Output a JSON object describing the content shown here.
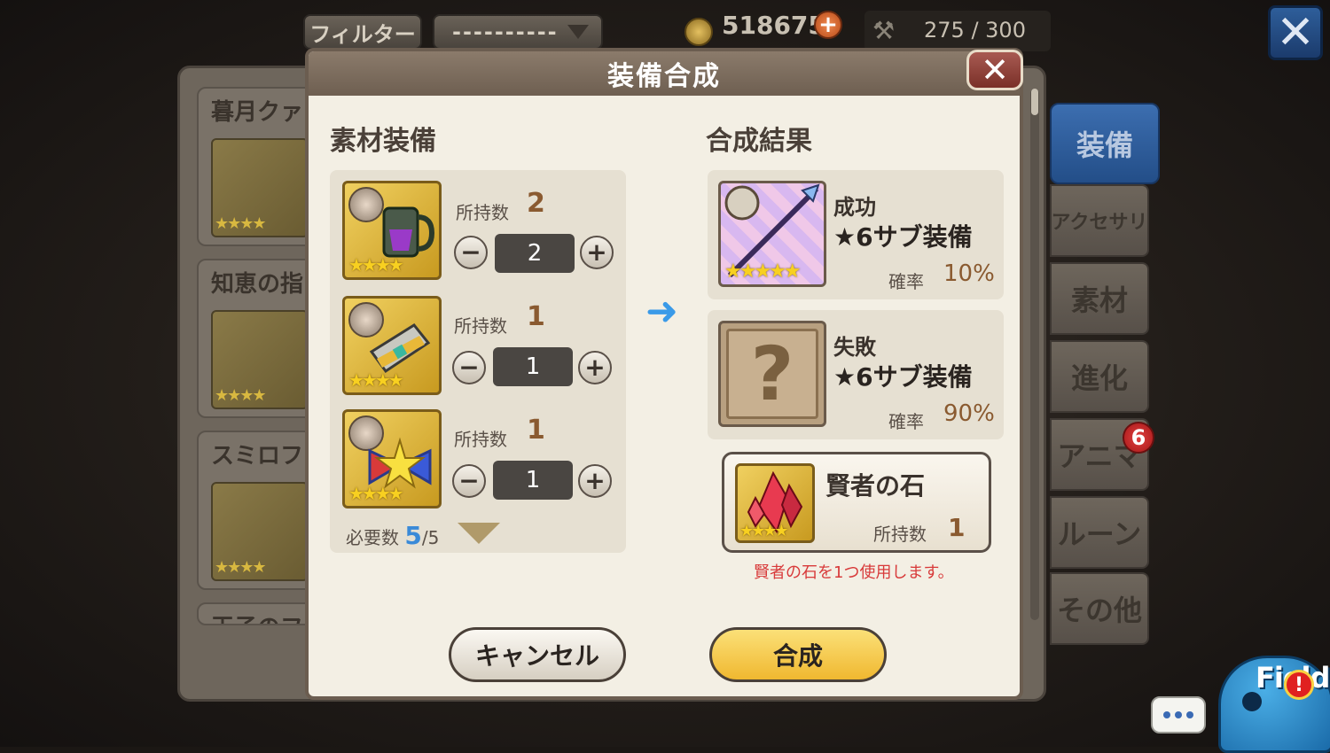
{
  "topbar": {
    "filter_label": "フィルター",
    "dropdown_value": "----------",
    "coins": "518675",
    "capacity": "275 / 300"
  },
  "list_cards": [
    {
      "title": "暮月クァ"
    },
    {
      "title": "知恵の指"
    },
    {
      "title": "スミロフ"
    },
    {
      "title": "王子のフ"
    }
  ],
  "tabs": [
    {
      "label": "装備"
    },
    {
      "label": "アクセサリ"
    },
    {
      "label": "素材"
    },
    {
      "label": "進化"
    },
    {
      "label": "アニマ"
    },
    {
      "label": "ルーン"
    },
    {
      "label": "その他"
    }
  ],
  "anima_badge": "6",
  "mascot_label": "Field",
  "dialog": {
    "title": "装備合成",
    "materials_header": "素材装備",
    "result_header": "合成結果",
    "owned_label": "所持数",
    "materials": [
      {
        "owned": "2",
        "qty": "2",
        "stars": "★★★★"
      },
      {
        "owned": "1",
        "qty": "1",
        "stars": "★★★★"
      },
      {
        "owned": "1",
        "qty": "1",
        "stars": "★★★★"
      }
    ],
    "required_label": "必要数",
    "required_count": "5",
    "required_total": "/5",
    "success": {
      "label": "成功",
      "name": "★6サブ装備",
      "prob_label": "確率",
      "prob": "10%",
      "stars": "★★★★★"
    },
    "failure": {
      "label": "失敗",
      "name": "★6サブ装備",
      "prob_label": "確率",
      "prob": "90%",
      "icon": "?"
    },
    "sage_stone": {
      "name": "賢者の石",
      "owned_label": "所持数",
      "owned": "1",
      "stars": "★★★★"
    },
    "note": "賢者の石を1つ使用します。",
    "cancel_label": "キャンセル",
    "combine_label": "合成"
  },
  "colors": {
    "accent_blue": "#3a8ad8",
    "gold_button": "#f0b830",
    "header_brown": "#7a6b5c",
    "note_red": "#d83a3a"
  }
}
